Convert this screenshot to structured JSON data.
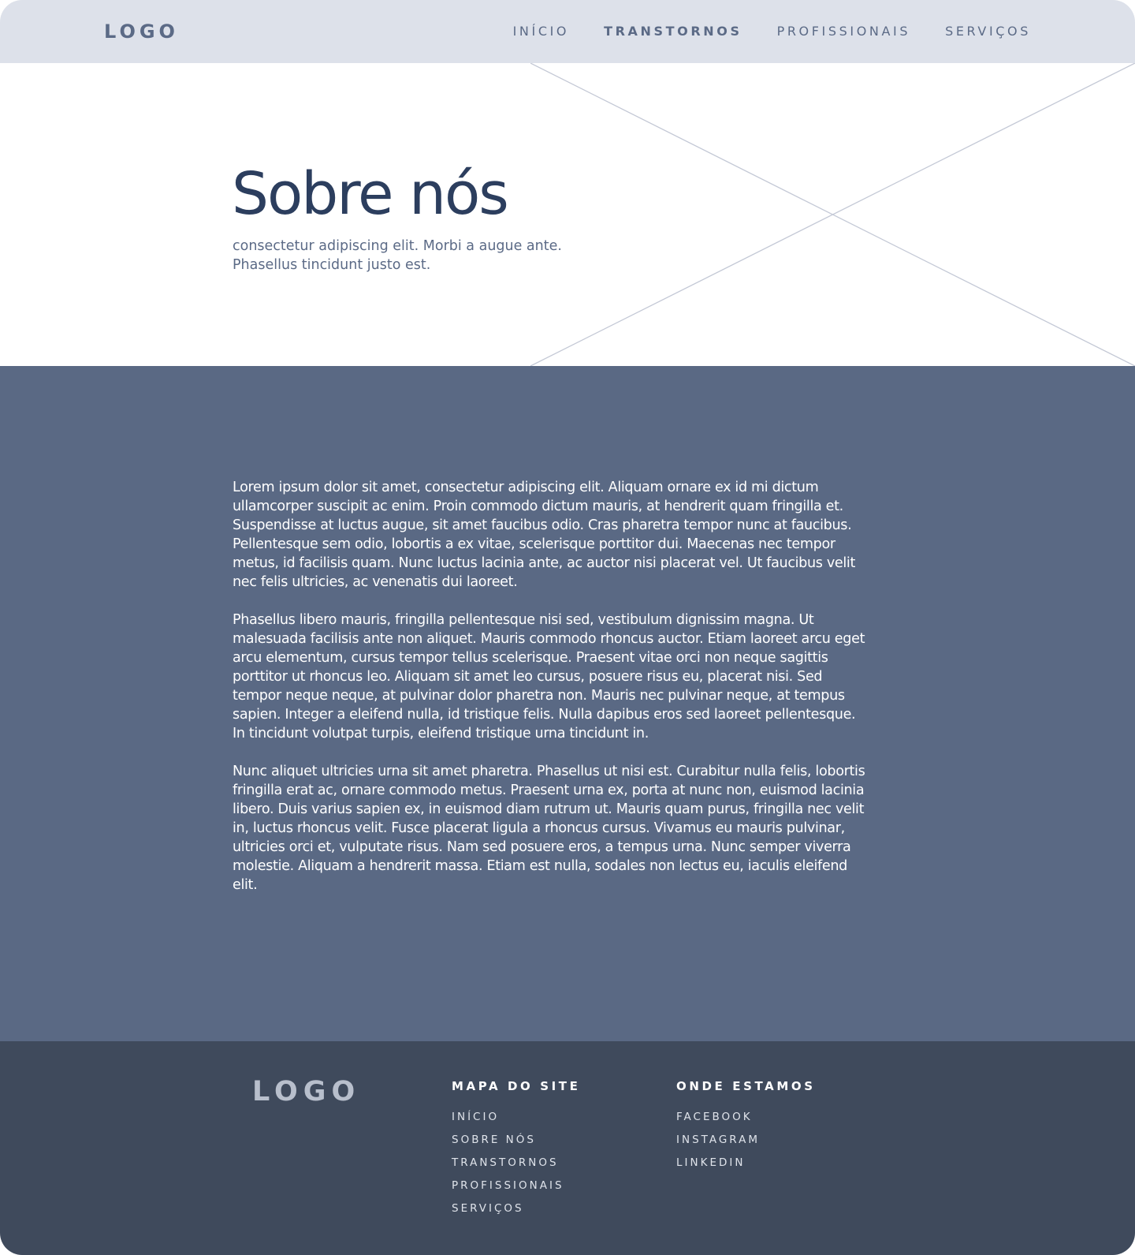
{
  "header": {
    "logo": "LOGO",
    "nav": [
      {
        "label": "INÍCIO"
      },
      {
        "label": "TRANSTORNOS",
        "active": true
      },
      {
        "label": "PROFISSIONAIS"
      },
      {
        "label": "SERVIÇOS"
      }
    ]
  },
  "hero": {
    "title": "Sobre nós",
    "subtitle": "consectetur adipiscing elit. Morbi a augue ante. Phasellus tincidunt justo est."
  },
  "content": {
    "paragraphs": [
      " Lorem ipsum dolor sit amet, consectetur adipiscing elit. Aliquam ornare ex id mi dictum ullamcorper suscipit ac enim. Proin commodo dictum mauris, at hendrerit quam fringilla et. Suspendisse at luctus augue, sit amet faucibus odio. Cras pharetra tempor nunc at faucibus. Pellentesque sem odio, lobortis a ex vitae, scelerisque porttitor dui. Maecenas nec tempor metus, id facilisis quam. Nunc luctus lacinia ante, ac auctor nisi placerat vel. Ut faucibus velit nec felis ultricies, ac venenatis dui laoreet.",
      "Phasellus libero mauris, fringilla pellentesque nisi sed, vestibulum dignissim magna. Ut malesuada facilisis ante non aliquet. Mauris commodo rhoncus auctor. Etiam laoreet arcu eget arcu elementum, cursus tempor tellus scelerisque. Praesent vitae orci non neque sagittis porttitor ut rhoncus leo. Aliquam sit amet leo cursus, posuere risus eu, placerat nisi. Sed tempor neque neque, at pulvinar dolor pharetra non. Mauris nec pulvinar neque, at tempus sapien. Integer a eleifend nulla, id tristique felis. Nulla dapibus eros sed laoreet pellentesque. In tincidunt volutpat turpis, eleifend tristique urna tincidunt in.",
      "Nunc aliquet ultricies urna sit amet pharetra. Phasellus ut nisi est. Curabitur nulla felis, lobortis fringilla erat ac, ornare commodo metus. Praesent urna ex, porta at nunc non, euismod lacinia libero. Duis varius sapien ex, in euismod diam rutrum ut. Mauris quam purus, fringilla nec velit in, luctus rhoncus velit. Fusce placerat ligula a rhoncus cursus. Vivamus eu mauris pulvinar, ultricies orci et, vulputate risus. Nam sed posuere eros, a tempus urna. Nunc semper viverra molestie. Aliquam a hendrerit massa. Etiam est nulla, sodales non lectus eu, iaculis eleifend elit."
    ]
  },
  "footer": {
    "logo": "LOGO",
    "sitemap": {
      "heading": "MAPA DO SITE",
      "links": [
        "INÍCIO",
        "SOBRE NÓS",
        "TRANSTORNOS",
        "PROFISSIONAIS",
        "SERVIÇOS"
      ]
    },
    "where": {
      "heading": "ONDE ESTAMOS",
      "links": [
        "FACEBOOK",
        "INSTAGRAM",
        "LINKEDIN"
      ]
    }
  },
  "colors": {
    "header_bg": "#dde1ea",
    "primary_text": "#2c3e5e",
    "muted_text": "#5b6a86",
    "content_bg": "#5a6984",
    "footer_bg": "#3f4a5c"
  }
}
